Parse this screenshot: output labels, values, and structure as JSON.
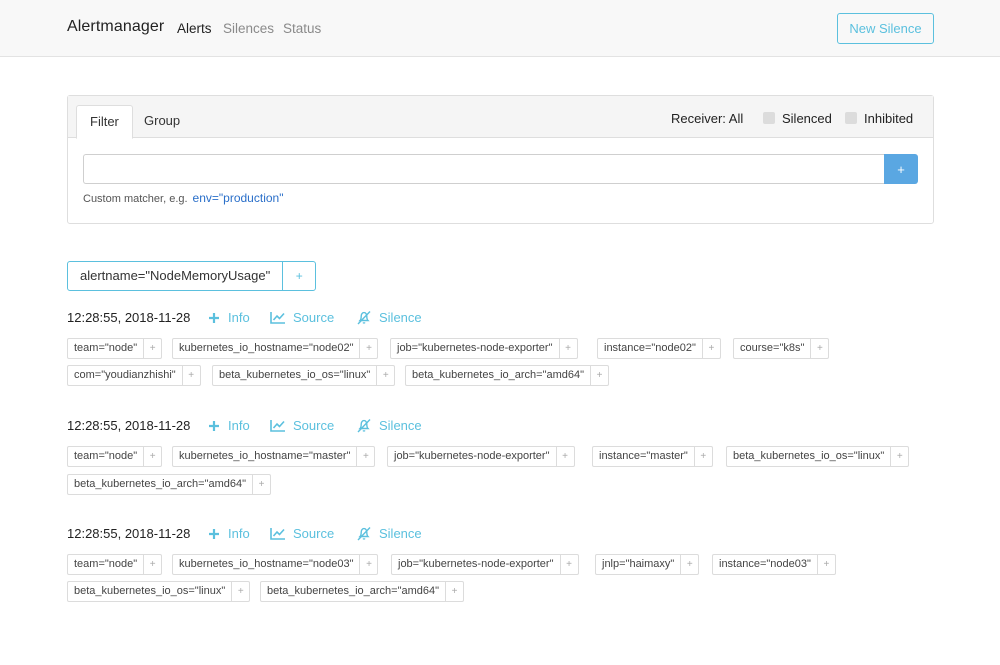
{
  "navbar": {
    "brand": "Alertmanager",
    "links": [
      "Alerts",
      "Silences",
      "Status"
    ],
    "new_silence": "New Silence"
  },
  "filter": {
    "tabs": [
      "Filter",
      "Group"
    ],
    "receiver": "Receiver: All",
    "silenced": "Silenced",
    "inhibited": "Inhibited",
    "input_value": "",
    "add_label": "+",
    "hint": "Custom matcher, e.g.",
    "hint_example": "env=\"production\""
  },
  "group": {
    "label": "alertname=\"NodeMemoryUsage\"",
    "add": "+"
  },
  "actions": {
    "info": "Info",
    "source": "Source",
    "silence": "Silence"
  },
  "alerts": [
    {
      "timestamp": "12:28:55, 2018-11-28",
      "labels": [
        "team=\"node\"",
        "kubernetes_io_hostname=\"node02\"",
        "job=\"kubernetes-node-exporter\"",
        "instance=\"node02\"",
        "course=\"k8s\"",
        "com=\"youdianzhishi\"",
        "beta_kubernetes_io_os=\"linux\"",
        "beta_kubernetes_io_arch=\"amd64\""
      ]
    },
    {
      "timestamp": "12:28:55, 2018-11-28",
      "labels": [
        "team=\"node\"",
        "kubernetes_io_hostname=\"master\"",
        "job=\"kubernetes-node-exporter\"",
        "instance=\"master\"",
        "beta_kubernetes_io_os=\"linux\"",
        "beta_kubernetes_io_arch=\"amd64\""
      ]
    },
    {
      "timestamp": "12:28:55, 2018-11-28",
      "labels": [
        "team=\"node\"",
        "kubernetes_io_hostname=\"node03\"",
        "job=\"kubernetes-node-exporter\"",
        "jnlp=\"haimaxy\"",
        "instance=\"node03\"",
        "beta_kubernetes_io_os=\"linux\"",
        "beta_kubernetes_io_arch=\"amd64\""
      ]
    }
  ],
  "label_add": "+",
  "colors": {
    "accent": "#5bc0de",
    "primary_button": "#5aa7e2",
    "link": "#2a6fc9"
  },
  "icons": {
    "info": "plus-icon",
    "source": "chart-line-icon",
    "silence": "bell-slash-icon"
  }
}
